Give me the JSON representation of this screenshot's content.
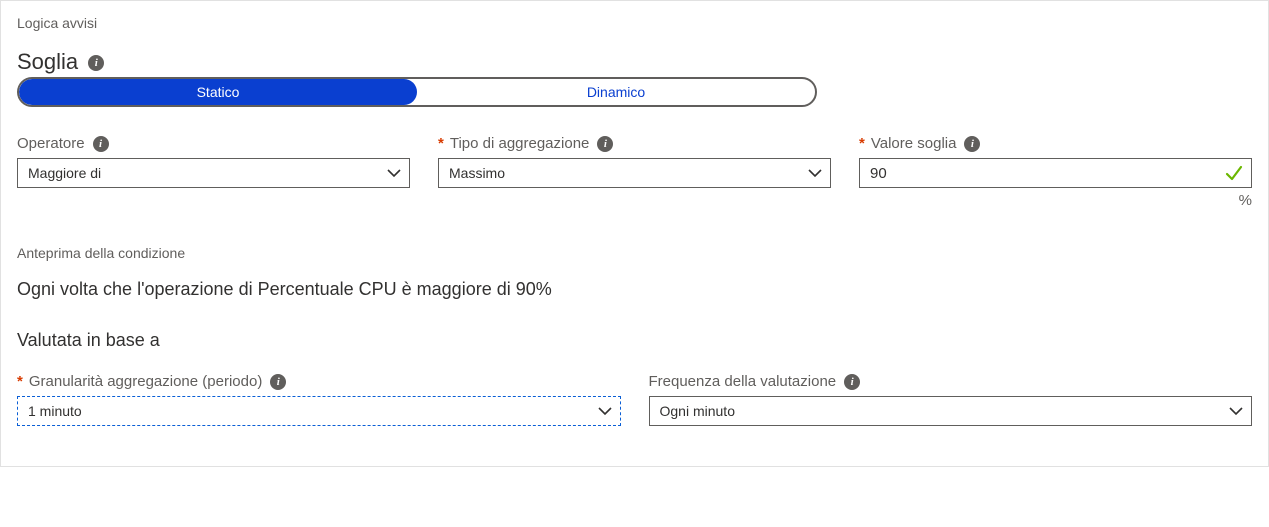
{
  "sectionLabel": "Logica avvisi",
  "thresholdHeading": "Soglia",
  "toggle": {
    "static": "Statico",
    "dynamic": "Dinamico"
  },
  "operator": {
    "label": "Operatore",
    "value": "Maggiore di"
  },
  "aggregation": {
    "label": "Tipo di aggregazione",
    "value": "Massimo"
  },
  "threshold": {
    "label": "Valore soglia",
    "value": "90",
    "unit": "%"
  },
  "preview": {
    "label": "Anteprima della condizione",
    "text": "Ogni volta che l'operazione di Percentuale CPU è maggiore di 90%"
  },
  "evaluatedHeading": "Valutata in base a",
  "granularity": {
    "label": "Granularità aggregazione (periodo)",
    "value": "1 minuto"
  },
  "frequency": {
    "label": "Frequenza della valutazione",
    "value": "Ogni minuto"
  },
  "icons": {
    "info": "i"
  }
}
